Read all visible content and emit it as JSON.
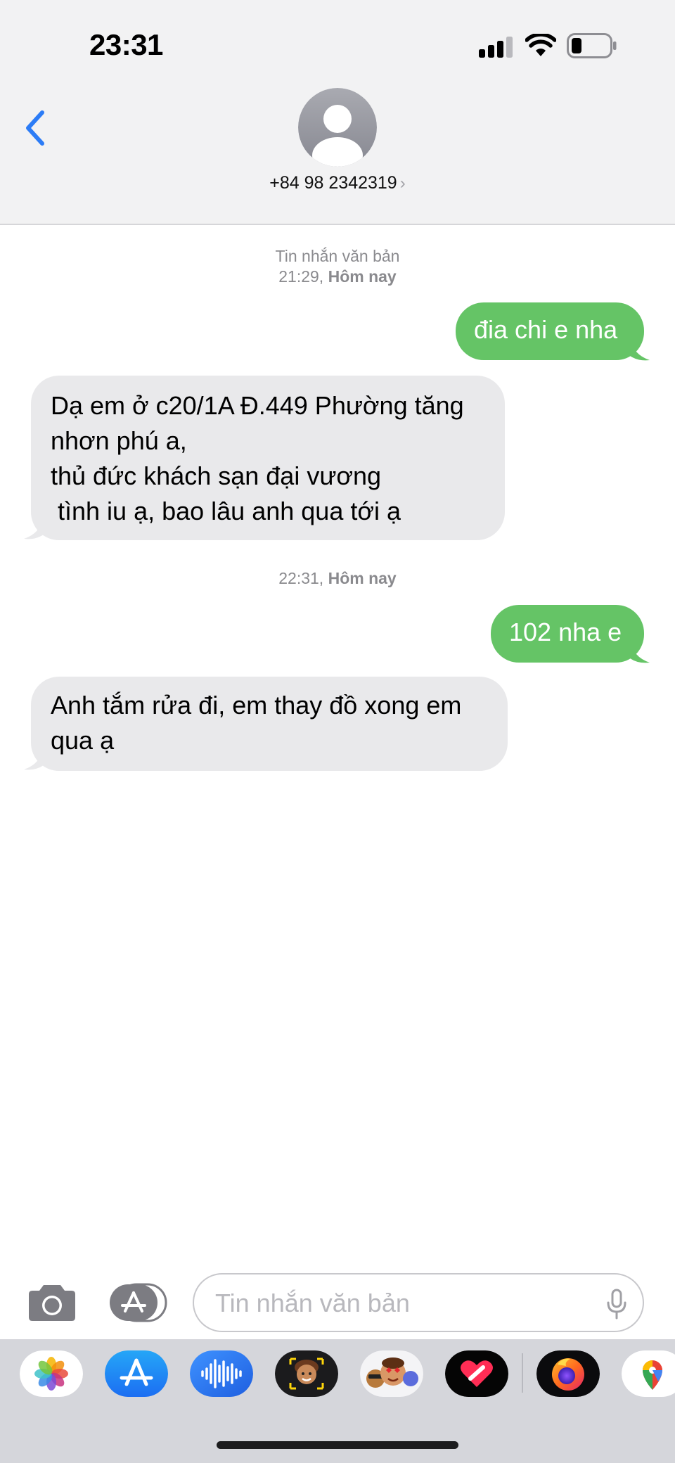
{
  "status_bar": {
    "time": "23:31"
  },
  "header": {
    "contact": "+84 98 2342319",
    "chevron": "›"
  },
  "conversation": {
    "timestamp1": {
      "label": "Tin nhắn văn bản",
      "time": "21:29,",
      "day": "Hôm nay"
    },
    "timestamp2": {
      "time": "22:31,",
      "day": "Hôm nay"
    },
    "messages": [
      {
        "direction": "sent",
        "lines": [
          "đia chi e nha"
        ]
      },
      {
        "direction": "received",
        "lines": [
          "Dạ em ở c20/1A Đ.449 Phường tăng",
          "nhơn phú a,",
          "thủ đức khách sạn đại vương",
          " tình iu ạ, bao lâu anh qua tới ạ"
        ]
      },
      {
        "direction": "sent",
        "lines": [
          "102 nha e"
        ]
      },
      {
        "direction": "received",
        "lines": [
          "Anh tắm rửa đi, em thay đồ xong em",
          "qua ạ"
        ]
      }
    ]
  },
  "input_bar": {
    "placeholder": "Tin nhắn văn bản",
    "value": ""
  },
  "app_drawer": {
    "apps": [
      "photos-icon",
      "app-store-icon",
      "audio-messages-icon",
      "memoji-icon",
      "memoji-stickers-icon",
      "digital-touch-icon",
      "firefox-icon",
      "google-maps-icon"
    ]
  },
  "colors": {
    "sent_bubble": "#65c466",
    "received_bubble": "#e9e9eb",
    "accent": "#2c7cf6",
    "header_bg": "#f2f2f3"
  }
}
